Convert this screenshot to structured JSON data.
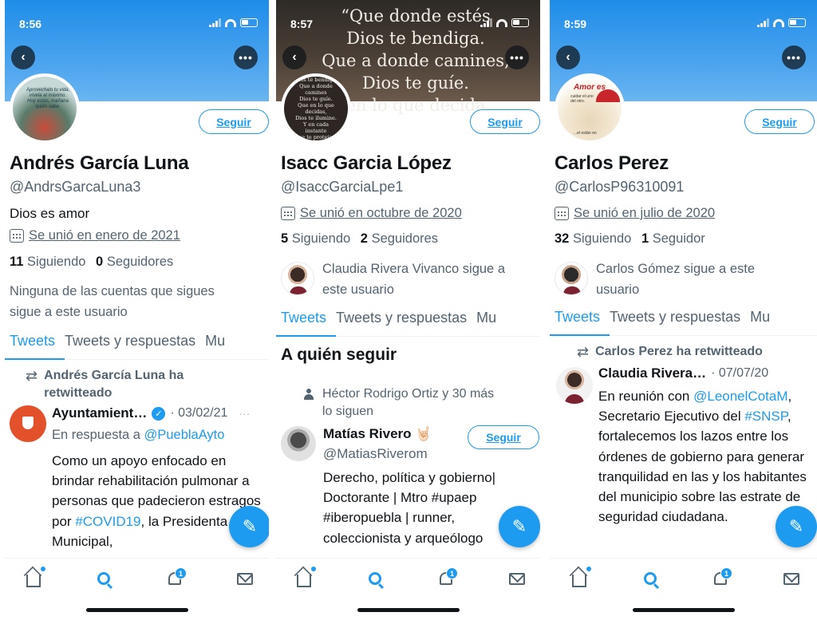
{
  "panels": [
    {
      "time": "8:56",
      "banner_text": "",
      "avatar_caption": "Aprovechalo tu vida,\nvívela al máximo.\nHoy estás, mañana\nquién sabe.",
      "follow_label": "Seguir",
      "name": "Andrés García Luna",
      "handle": "@AndrsGarcaLuna3",
      "bio": "Dios es amor",
      "joined": "Se unió en enero de 2021",
      "following_count": "11",
      "following_label": "Siguiendo",
      "followers_count": "0",
      "followers_label": "Seguidores",
      "followed_by": "Ninguna de las cuentas que sigues\nsigue a este usuario",
      "tabs": [
        "Tweets",
        "Tweets y respuestas",
        "Mu"
      ],
      "retweet_label": "Andrés García Luna ha\nretwitteado",
      "tweet": {
        "author": "Ayuntamient…",
        "date": "· 03/02/21",
        "reply_prefix": "En respuesta a",
        "reply_to": "@PueblaAyto",
        "body_1": "Como un apoyo enfocado en brindar rehabilitación pulmonar a personas que padecieron estragos por",
        "hashtag": "#COVID19",
        "body_2": ", la Presidenta Municipal,"
      },
      "notif_badge": "1"
    },
    {
      "time": "8:57",
      "banner_text": "“Que donde estés\nDios te bendiga.\nQue a donde camines,\nDios te guíe.\nen lo que decida",
      "avatar_caption": "“Que donde estés\nDios te bendiga.\nQue a donde camines\nDios te guíe.\nQue en lo que decidas,\nDios te ilumine.\nY en cada instante\nque te proteja y te aparte\ndel mal”",
      "follow_label": "Seguir",
      "name": "Isacc Garcia López",
      "handle": "@IsaccGarciaLpe1",
      "joined": "Se unió en octubre de 2020",
      "following_count": "5",
      "following_label": "Siguiendo",
      "followers_count": "2",
      "followers_label": "Seguidores",
      "followed_by": "Claudia Rivera Vivanco sigue a\neste usuario",
      "tabs": [
        "Tweets",
        "Tweets y respuestas",
        "Mu"
      ],
      "who_to_follow": "A quién seguir",
      "suggestion_note": "Héctor Rodrigo Ortiz y 30 más\nlo siguen",
      "suggestion": {
        "name": "Matías Rivero 🤘🏻",
        "handle": "@MatiasRiverom",
        "button": "Seguir",
        "bio": "Derecho, política y gobierno| Doctorante | Mtro #upaep #iberopuebla | runner, coleccionista y arqueólogo"
      },
      "notif_badge": "1"
    },
    {
      "time": "8:59",
      "banner_text": "",
      "avatar_caption": "Amor es",
      "avatar_sub": "cuidar el uno\ndel otro.",
      "avatar_foot": "...el están en",
      "follow_label": "Seguir",
      "name": "Carlos Perez",
      "handle": "@CarlosP96310091",
      "joined": "Se unió en julio de 2020",
      "following_count": "32",
      "following_label": "Siguiendo",
      "followers_count": "1",
      "followers_label": "Seguidor",
      "followed_by": "Carlos Gómez sigue a este\nusuario",
      "tabs": [
        "Tweets",
        "Tweets y respuestas",
        "Mu"
      ],
      "retweet_label": "Carlos Perez ha retwitteado",
      "tweet": {
        "author": "Claudia Rivera…",
        "date": "· 07/07/20",
        "body_1": "En reunión con",
        "mention": "@LeonelCotaM",
        "body_2": ", Secretario Ejecutivo del",
        "hashtag": "#SNSP",
        "body_3": ", fortalecemos los lazos entre los órdenes de gobierno para generar tranquilidad en las y los habitantes del municipio sobre las estrate de seguridad ciudadana."
      },
      "notif_badge": "1"
    }
  ],
  "icons": {
    "back": "chevron-left-icon",
    "more": "more-icon",
    "calendar": "calendar-icon",
    "retweet": "retweet-icon",
    "compose": "compose-icon",
    "home": "home-icon",
    "search": "search-icon",
    "notifications": "bell-icon",
    "messages": "mail-icon"
  },
  "colors": {
    "accent": "#1d9bf0",
    "text": "#0f1419",
    "muted": "#536471",
    "banner": "#1e8de8"
  }
}
